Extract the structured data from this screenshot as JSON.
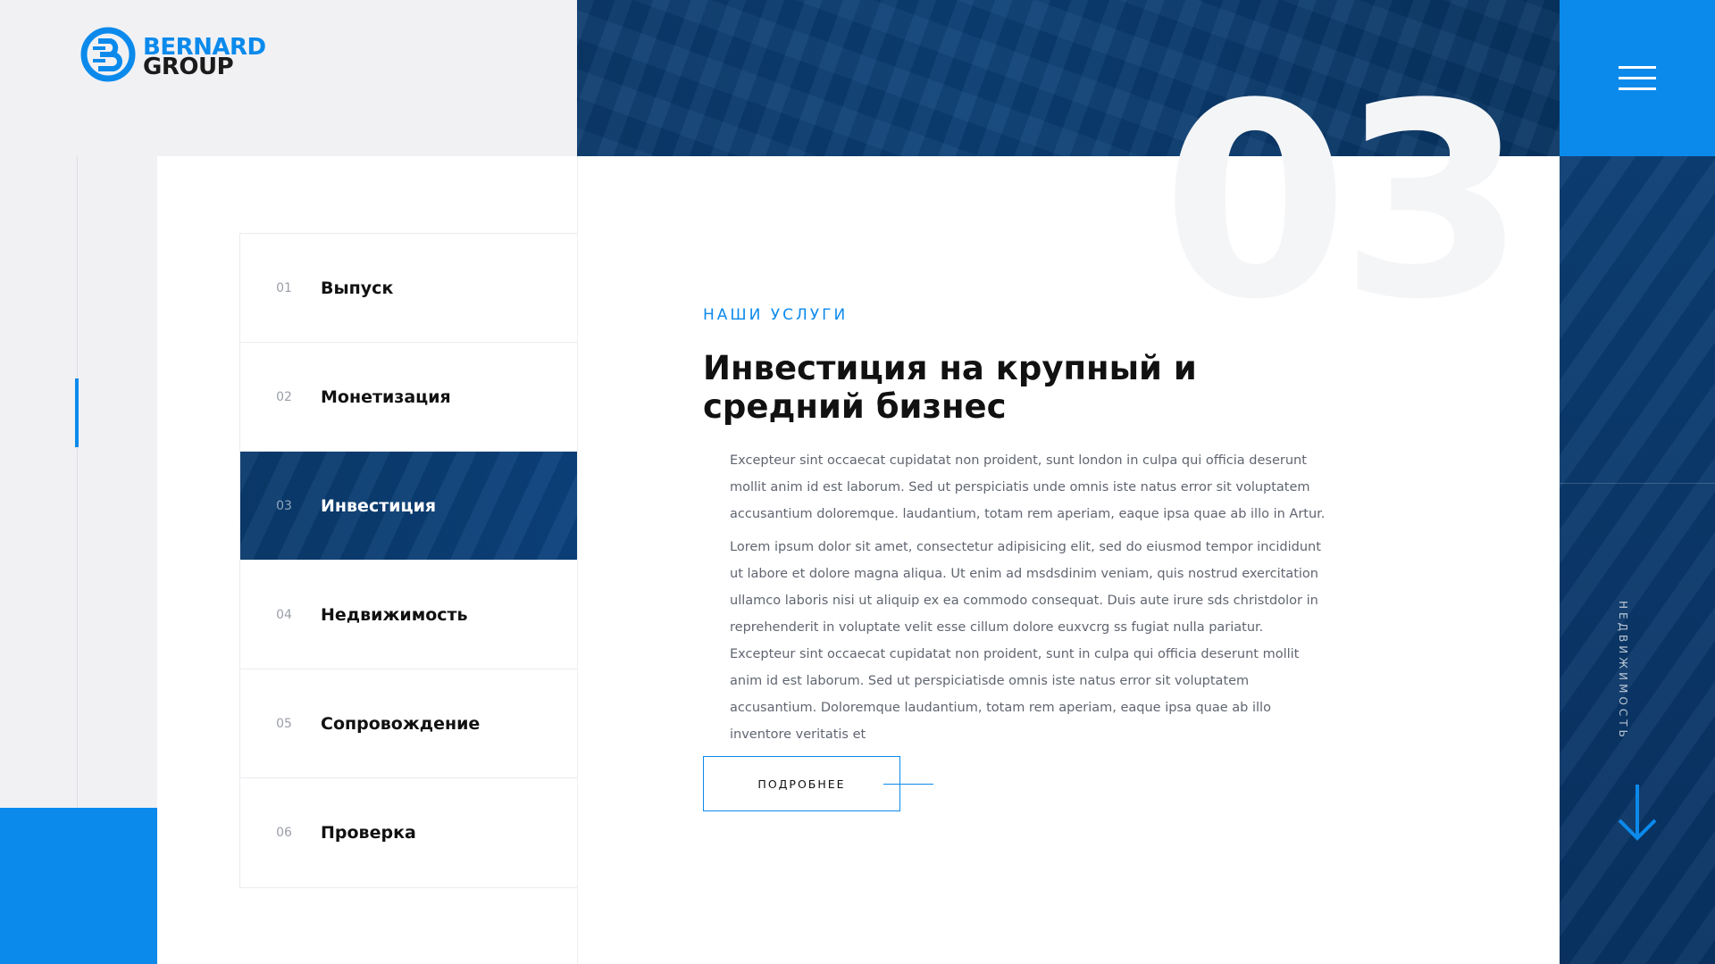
{
  "brand": {
    "line1": "BERNARD",
    "line2": "GROUP",
    "icon": "bernard-b-logo-icon",
    "primary_color": "#0b8aec",
    "dark_color": "#0a3a6c"
  },
  "header": {
    "menu_icon": "hamburger-menu-icon"
  },
  "services": {
    "active_index": 2,
    "items": [
      {
        "num": "01",
        "label": "Выпуск"
      },
      {
        "num": "02",
        "label": "Монетизация"
      },
      {
        "num": "03",
        "label": "Инвестиция"
      },
      {
        "num": "04",
        "label": "Недвижимость"
      },
      {
        "num": "05",
        "label": "Сопровождение"
      },
      {
        "num": "06",
        "label": "Проверка"
      }
    ]
  },
  "content": {
    "big_number": "03",
    "eyebrow": "НАШИ УСЛУГИ",
    "heading": "Инвестиция на крупный и средний бизнес",
    "paragraph1": "Excepteur sint occaecat cupidatat non proident, sunt london in culpa qui officia deserunt mollit anim id est laborum. Sed ut perspiciatis unde omnis iste natus error sit voluptatem accusantium doloremque. laudantium, totam rem aperiam, eaque ipsa quae ab illo in Artur.",
    "paragraph2": "Lorem ipsum dolor sit amet, consectetur adipisicing elit, sed do eiusmod tempor incididunt ut labore et dolore magna aliqua. Ut enim ad msdsdinim veniam, quis nostrud exercitation ullamco laboris nisi ut aliquip ex ea commodo consequat. Duis aute irure sds christdolor in reprehenderit in voluptate velit esse cillum dolore euxvcrg ss fugiat nulla pariatur. Excepteur sint occaecat cupidatat non proident, sunt in culpa qui officia deserunt mollit anim id est laborum. Sed ut perspiciatisde omnis iste natus error sit voluptatem accusantium. Doloremque laudantium, totam rem aperiam, eaque ipsa quae ab illo inventore veritatis et",
    "button_label": "ПОДРОБНЕЕ"
  },
  "side": {
    "next_label": "НЕДВИЖИМОСТЬ",
    "arrow_icon": "arrow-down-icon"
  }
}
